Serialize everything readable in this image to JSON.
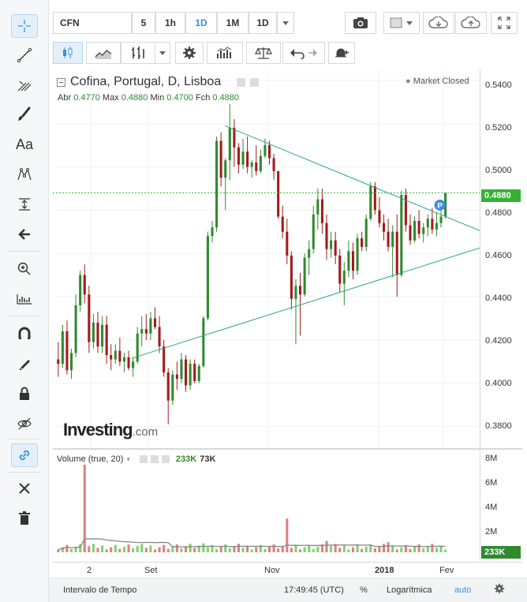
{
  "toolbar_top": {
    "symbol": "CFN",
    "intervals": [
      "5",
      "1h",
      "1D",
      "1M",
      "1D"
    ],
    "active_interval": "1D"
  },
  "legend": {
    "title": "Cofina, Portugal, D, Lisboa",
    "open_label": "Abr",
    "open": "0.4770",
    "high_label": "Max",
    "high": "0.4880",
    "low_label": "Min",
    "low": "0.4700",
    "close_label": "Fch",
    "close": "0.4880",
    "status": "Market Closed"
  },
  "volume_legend": {
    "label": "Volume (true, 20)",
    "value1": "233K",
    "value2": "73K"
  },
  "watermark": {
    "brand": "Investing",
    "suffix": ".com"
  },
  "price_axis": [
    "0.5400",
    "0.5200",
    "0.5000",
    "0.4800",
    "0.4600",
    "0.4400",
    "0.4200",
    "0.4000",
    "0.3800"
  ],
  "current_price": "0.4880",
  "volume_axis": [
    "8M",
    "6M",
    "4M",
    "2M"
  ],
  "current_volume": "233K",
  "time_axis": [
    "2",
    "Set",
    "Nov",
    "2018",
    "Fev"
  ],
  "bottom_bar": {
    "range": "Intervalo de Tempo",
    "clock": "17:49:45 (UTC)",
    "percent": "%",
    "log": "Logarítmica",
    "auto": "auto"
  },
  "colors": {
    "up": "#2e8a2e",
    "down": "#a11b1b",
    "trendline": "#2aa68a",
    "price_line": "#36b136",
    "accent": "#3d8fdb",
    "volume_up": "#7ed26e",
    "volume_down": "#e08080",
    "volume_ma": "#888888"
  },
  "chart_data": {
    "type": "candlestick",
    "title": "Cofina, Portugal, D, Lisboa",
    "ylim": [
      0.37,
      0.545
    ],
    "ohlc": [
      [
        0.411,
        0.419,
        0.403,
        0.409
      ],
      [
        0.409,
        0.427,
        0.407,
        0.424
      ],
      [
        0.424,
        0.429,
        0.404,
        0.406
      ],
      [
        0.406,
        0.416,
        0.402,
        0.414
      ],
      [
        0.414,
        0.441,
        0.412,
        0.436
      ],
      [
        0.436,
        0.452,
        0.433,
        0.45
      ],
      [
        0.45,
        0.455,
        0.437,
        0.441
      ],
      [
        0.441,
        0.445,
        0.414,
        0.419
      ],
      [
        0.419,
        0.432,
        0.416,
        0.428
      ],
      [
        0.428,
        0.433,
        0.414,
        0.417
      ],
      [
        0.417,
        0.431,
        0.414,
        0.427
      ],
      [
        0.427,
        0.431,
        0.409,
        0.413
      ],
      [
        0.413,
        0.418,
        0.406,
        0.411
      ],
      [
        0.411,
        0.418,
        0.409,
        0.415
      ],
      [
        0.415,
        0.421,
        0.408,
        0.41
      ],
      [
        0.41,
        0.414,
        0.405,
        0.412
      ],
      [
        0.412,
        0.415,
        0.406,
        0.407
      ],
      [
        0.407,
        0.412,
        0.403,
        0.41
      ],
      [
        0.41,
        0.426,
        0.409,
        0.423
      ],
      [
        0.423,
        0.431,
        0.417,
        0.425
      ],
      [
        0.425,
        0.432,
        0.42,
        0.423
      ],
      [
        0.423,
        0.433,
        0.42,
        0.43
      ],
      [
        0.43,
        0.435,
        0.425,
        0.426
      ],
      [
        0.426,
        0.431,
        0.414,
        0.417
      ],
      [
        0.417,
        0.42,
        0.403,
        0.405
      ],
      [
        0.405,
        0.407,
        0.381,
        0.392
      ],
      [
        0.392,
        0.406,
        0.39,
        0.404
      ],
      [
        0.404,
        0.41,
        0.397,
        0.402
      ],
      [
        0.402,
        0.414,
        0.4,
        0.411
      ],
      [
        0.411,
        0.413,
        0.396,
        0.399
      ],
      [
        0.399,
        0.411,
        0.397,
        0.409
      ],
      [
        0.409,
        0.411,
        0.4,
        0.401
      ],
      [
        0.401,
        0.409,
        0.4,
        0.408
      ],
      [
        0.408,
        0.431,
        0.407,
        0.43
      ],
      [
        0.43,
        0.47,
        0.429,
        0.468
      ],
      [
        0.468,
        0.475,
        0.465,
        0.472
      ],
      [
        0.472,
        0.514,
        0.47,
        0.512
      ],
      [
        0.512,
        0.516,
        0.491,
        0.495
      ],
      [
        0.495,
        0.504,
        0.48,
        0.503
      ],
      [
        0.503,
        0.529,
        0.494,
        0.518
      ],
      [
        0.518,
        0.522,
        0.5,
        0.509
      ],
      [
        0.509,
        0.511,
        0.497,
        0.501
      ],
      [
        0.501,
        0.513,
        0.499,
        0.507
      ],
      [
        0.507,
        0.514,
        0.497,
        0.5
      ],
      [
        0.5,
        0.503,
        0.495,
        0.502
      ],
      [
        0.502,
        0.51,
        0.496,
        0.498
      ],
      [
        0.498,
        0.508,
        0.497,
        0.505
      ],
      [
        0.505,
        0.513,
        0.504,
        0.51
      ],
      [
        0.51,
        0.512,
        0.501,
        0.504
      ],
      [
        0.504,
        0.506,
        0.494,
        0.498
      ],
      [
        0.498,
        0.478,
        0.476,
        0.477
      ],
      [
        0.477,
        0.482,
        0.467,
        0.47
      ],
      [
        0.47,
        0.476,
        0.455,
        0.459
      ],
      [
        0.459,
        0.461,
        0.434,
        0.439
      ],
      [
        0.439,
        0.448,
        0.418,
        0.445
      ],
      [
        0.445,
        0.451,
        0.422,
        0.441
      ],
      [
        0.441,
        0.46,
        0.44,
        0.458
      ],
      [
        0.458,
        0.466,
        0.45,
        0.462
      ],
      [
        0.462,
        0.482,
        0.46,
        0.478
      ],
      [
        0.478,
        0.49,
        0.471,
        0.485
      ],
      [
        0.485,
        0.49,
        0.469,
        0.474
      ],
      [
        0.474,
        0.478,
        0.457,
        0.462
      ],
      [
        0.462,
        0.47,
        0.458,
        0.466
      ],
      [
        0.466,
        0.47,
        0.455,
        0.459
      ],
      [
        0.459,
        0.462,
        0.442,
        0.446
      ],
      [
        0.446,
        0.456,
        0.436,
        0.452
      ],
      [
        0.452,
        0.466,
        0.449,
        0.461
      ],
      [
        0.461,
        0.465,
        0.448,
        0.452
      ],
      [
        0.452,
        0.469,
        0.45,
        0.467
      ],
      [
        0.467,
        0.47,
        0.461,
        0.463
      ],
      [
        0.463,
        0.478,
        0.461,
        0.476
      ],
      [
        0.476,
        0.493,
        0.475,
        0.491
      ],
      [
        0.491,
        0.493,
        0.478,
        0.48
      ],
      [
        0.48,
        0.486,
        0.472,
        0.474
      ],
      [
        0.474,
        0.478,
        0.466,
        0.47
      ],
      [
        0.47,
        0.476,
        0.461,
        0.463
      ],
      [
        0.463,
        0.473,
        0.449,
        0.47
      ],
      [
        0.47,
        0.478,
        0.44,
        0.45
      ],
      [
        0.45,
        0.489,
        0.449,
        0.487
      ],
      [
        0.487,
        0.49,
        0.47,
        0.473
      ],
      [
        0.473,
        0.478,
        0.464,
        0.466
      ],
      [
        0.466,
        0.477,
        0.465,
        0.475
      ],
      [
        0.475,
        0.48,
        0.467,
        0.469
      ],
      [
        0.469,
        0.474,
        0.465,
        0.472
      ],
      [
        0.472,
        0.478,
        0.468,
        0.476
      ],
      [
        0.476,
        0.481,
        0.469,
        0.471
      ],
      [
        0.471,
        0.479,
        0.468,
        0.474
      ],
      [
        0.474,
        0.482,
        0.472,
        0.477
      ],
      [
        0.477,
        0.488,
        0.476,
        0.488
      ]
    ],
    "volume_up_idx": [
      6,
      33,
      52,
      61,
      75
    ],
    "y_ticks": [
      0.54,
      0.52,
      0.5,
      0.48,
      0.46,
      0.44,
      0.42,
      0.4,
      0.38
    ],
    "volume_ticks": [
      "8M",
      "6M",
      "4M",
      "2M"
    ],
    "x_ticks": [
      "2",
      "Set",
      "Nov",
      "2018",
      "Fev"
    ]
  }
}
